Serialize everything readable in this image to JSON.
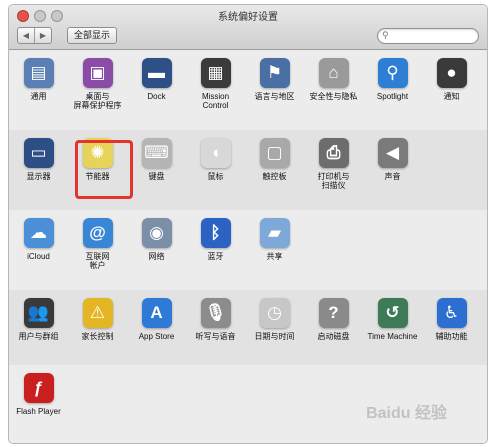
{
  "window": {
    "title": "系统偏好设置",
    "show_all": "全部显示",
    "search": {
      "placeholder": "",
      "value": ""
    }
  },
  "rows": [
    {
      "items": [
        {
          "name": "general",
          "label": "通用",
          "icon": "general-icon",
          "glyph": "▤",
          "color": "#5b7fb3"
        },
        {
          "name": "desktop-screensaver",
          "label": "桌面与\n屏幕保护程序",
          "icon": "desktop-icon",
          "glyph": "▣",
          "color": "#8b4ca8"
        },
        {
          "name": "dock",
          "label": "Dock",
          "icon": "dock-icon",
          "glyph": "▬",
          "color": "#2f4f87"
        },
        {
          "name": "mission-control",
          "label": "Mission\nControl",
          "icon": "mission-control-icon",
          "glyph": "▦",
          "color": "#3b3b3b"
        },
        {
          "name": "language-region",
          "label": "语言与地区",
          "icon": "flag-icon",
          "glyph": "⚑",
          "color": "#4a6fa5"
        },
        {
          "name": "security-privacy",
          "label": "安全性与隐私",
          "icon": "house-lock-icon",
          "glyph": "⌂",
          "color": "#9a9a9a"
        },
        {
          "name": "spotlight",
          "label": "Spotlight",
          "icon": "magnifier-icon",
          "glyph": "⚲",
          "color": "#2e7fd4"
        },
        {
          "name": "notifications",
          "label": "通知",
          "icon": "notifications-icon",
          "glyph": "●",
          "color": "#3a3a3a"
        }
      ]
    },
    {
      "items": [
        {
          "name": "displays",
          "label": "显示器",
          "icon": "display-icon",
          "glyph": "▭",
          "color": "#2d4f86"
        },
        {
          "name": "energy-saver",
          "label": "节能器",
          "icon": "lightbulb-icon",
          "glyph": "✺",
          "color": "#e8d35a"
        },
        {
          "name": "keyboard",
          "label": "键盘",
          "icon": "keyboard-icon",
          "glyph": "⌨",
          "color": "#b5b5b5"
        },
        {
          "name": "mouse",
          "label": "鼠标",
          "icon": "mouse-icon",
          "glyph": "◖",
          "color": "#d8d8d8"
        },
        {
          "name": "trackpad",
          "label": "触控板",
          "icon": "trackpad-icon",
          "glyph": "▢",
          "color": "#a9a9a9"
        },
        {
          "name": "printers-scanners",
          "label": "打印机与\n扫描仪",
          "icon": "printer-icon",
          "glyph": "⎙",
          "color": "#6d6d6d"
        },
        {
          "name": "sound",
          "label": "声音",
          "icon": "speaker-icon",
          "glyph": "◀",
          "color": "#7a7a7a"
        }
      ]
    },
    {
      "items": [
        {
          "name": "icloud",
          "label": "iCloud",
          "icon": "cloud-icon",
          "glyph": "☁",
          "color": "#4a8fd8"
        },
        {
          "name": "internet-accounts",
          "label": "互联网\n帐户",
          "icon": "at-icon",
          "glyph": "@",
          "color": "#3a86d6"
        },
        {
          "name": "network",
          "label": "网络",
          "icon": "globe-icon",
          "glyph": "◉",
          "color": "#7c8fa8"
        },
        {
          "name": "bluetooth",
          "label": "蓝牙",
          "icon": "bluetooth-icon",
          "glyph": "ᛒ",
          "color": "#2c63c2"
        },
        {
          "name": "sharing",
          "label": "共享",
          "icon": "folder-icon",
          "glyph": "▰",
          "color": "#7da8d8"
        }
      ]
    },
    {
      "items": [
        {
          "name": "users-groups",
          "label": "用户与群组",
          "icon": "users-icon",
          "glyph": "👥",
          "color": "#3a3a3a"
        },
        {
          "name": "parental-controls",
          "label": "家长控制",
          "icon": "parental-icon",
          "glyph": "⚠",
          "color": "#e4b623"
        },
        {
          "name": "app-store",
          "label": "App Store",
          "icon": "app-store-icon",
          "glyph": "A",
          "color": "#2f7ad6"
        },
        {
          "name": "dictation-speech",
          "label": "听写与语音",
          "icon": "microphone-icon",
          "glyph": "🎙",
          "color": "#8c8c8c"
        },
        {
          "name": "date-time",
          "label": "日期与时间",
          "icon": "clock-icon",
          "glyph": "◷",
          "color": "#c7c7c7"
        },
        {
          "name": "startup-disk",
          "label": "启动磁盘",
          "icon": "disk-icon",
          "glyph": "?",
          "color": "#8a8a8a"
        },
        {
          "name": "time-machine",
          "label": "Time Machine",
          "icon": "time-machine-icon",
          "glyph": "↺",
          "color": "#3d7a56"
        },
        {
          "name": "accessibility",
          "label": "辅助功能",
          "icon": "accessibility-icon",
          "glyph": "♿",
          "color": "#2d6fd0"
        }
      ]
    },
    {
      "items": [
        {
          "name": "flash-player",
          "label": "Flash Player",
          "icon": "flash-icon",
          "glyph": "ƒ",
          "color": "#c91f1f"
        }
      ]
    }
  ],
  "watermark": "Baidu 经验",
  "colors": {
    "highlight": "#e2342c"
  }
}
